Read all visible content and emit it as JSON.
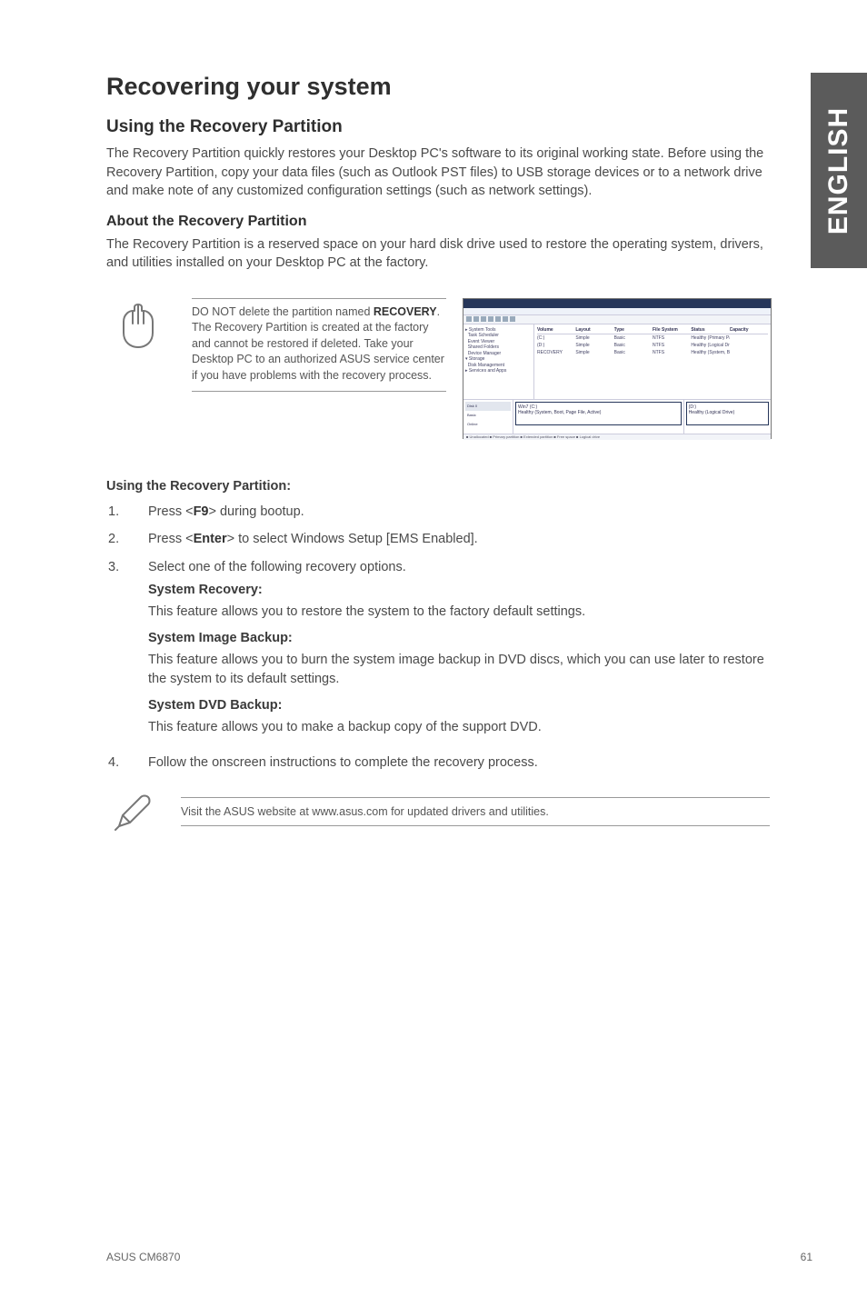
{
  "side_tab": "ENGLISH",
  "title": "Recovering your system",
  "subtitle": "Using the Recovery Partition",
  "intro": "The Recovery Partition quickly restores your Desktop PC's software to its original working state. Before using the Recovery Partition, copy your data files (such as Outlook PST files) to USB storage devices or to a network drive and make note of any customized configuration settings (such as network settings).",
  "about_heading": "About the Recovery Partition",
  "about_text": "The Recovery Partition is a reserved space on your hard disk drive used to restore the operating system, drivers, and utilities installed on your Desktop PC at the factory.",
  "callout": {
    "prefix": "DO NOT delete the partition named ",
    "bold": "RECOVERY",
    "suffix": ". The Recovery Partition is created at the factory and cannot be restored if deleted. Take your Desktop PC to an authorized ASUS service center if you have problems with the recovery process."
  },
  "using_heading": "Using the Recovery Partition:",
  "steps": {
    "s1a": "Press <",
    "s1b": "F9",
    "s1c": "> during bootup.",
    "s2a": "Press <",
    "s2b": "Enter",
    "s2c": "> to select Windows Setup [EMS Enabled].",
    "s3": "Select one of the following recovery options.",
    "opt1_title": "System Recovery:",
    "opt1_text": "This feature allows you to restore the system to the factory default settings.",
    "opt2_title": "System Image Backup:",
    "opt2_text": "This feature allows you to burn the system image backup in DVD discs, which you can use later to restore the system to its default settings.",
    "opt3_title": "System DVD Backup:",
    "opt3_text": "This feature allows you to make a backup copy of the support DVD.",
    "s4": "Follow the onscreen instructions to complete the recovery process."
  },
  "note": "Visit the ASUS website at www.asus.com for updated drivers and utilities.",
  "footer": {
    "model": "ASUS CM6870",
    "page": "61"
  }
}
